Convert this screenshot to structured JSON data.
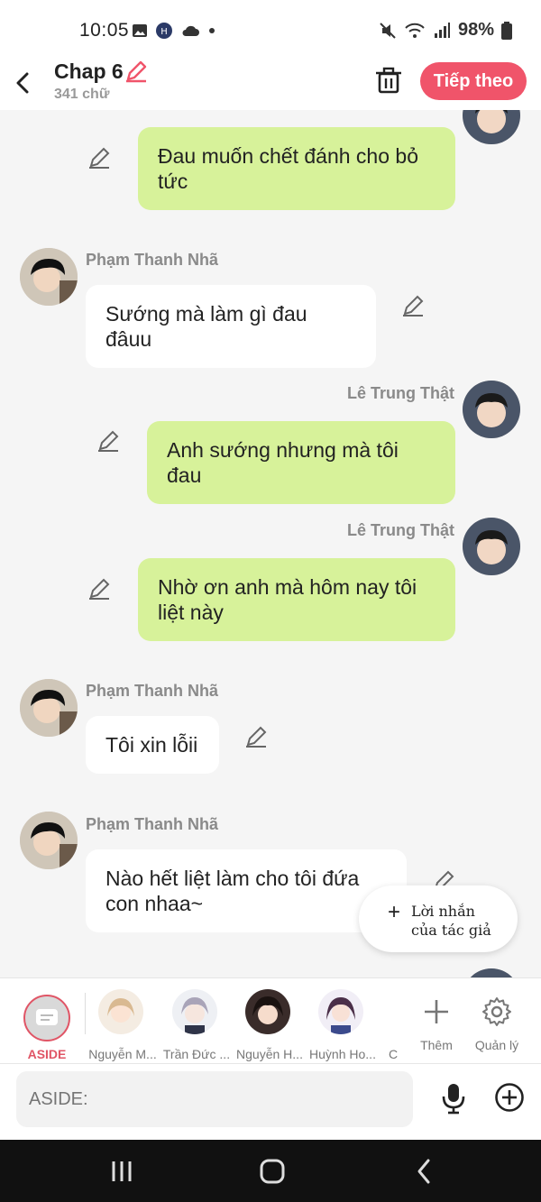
{
  "status": {
    "time": "10:05",
    "battery": "98%"
  },
  "header": {
    "title": "Chap 6",
    "word_count": "341 chữ",
    "next_label": "Tiếp theo"
  },
  "messages": [
    {
      "side": "right",
      "text_lines": [
        "Đau muốn chết đánh cho bỏ",
        "tức"
      ]
    },
    {
      "side": "left",
      "sender": "Phạm Thanh Nhã",
      "text": "Sướng mà làm gì đau đâuu"
    },
    {
      "side": "right",
      "sender": "Lê Trung Thật",
      "text": "Anh sướng nhưng mà tôi đau"
    },
    {
      "side": "right",
      "sender": "Lê Trung Thật",
      "text_lines": [
        "Nhờ ơn anh mà hôm nay tôi",
        "liệt này"
      ]
    },
    {
      "side": "left",
      "sender": "Phạm Thanh Nhã",
      "text": "Tôi xin lỗii"
    },
    {
      "side": "left",
      "sender": "Phạm Thanh Nhã",
      "text_lines": [
        "Nào hết liệt làm cho tôi đứa",
        "con nhaa~"
      ]
    }
  ],
  "fab": {
    "line1": "Lời nhắn",
    "line2": "của tác giả"
  },
  "characters": {
    "aside": "ASIDE",
    "items": [
      "Nguyễn M...",
      "Trần Đức ...",
      "Nguyễn H...",
      "Huỳnh Ho...",
      "C"
    ],
    "add_label": "Thêm",
    "manage_label": "Quản lý"
  },
  "input": {
    "placeholder": "ASIDE:"
  },
  "colors": {
    "accent": "#f0546a",
    "bubble_right": "#d7f29a",
    "bubble_left": "#ffffff"
  }
}
